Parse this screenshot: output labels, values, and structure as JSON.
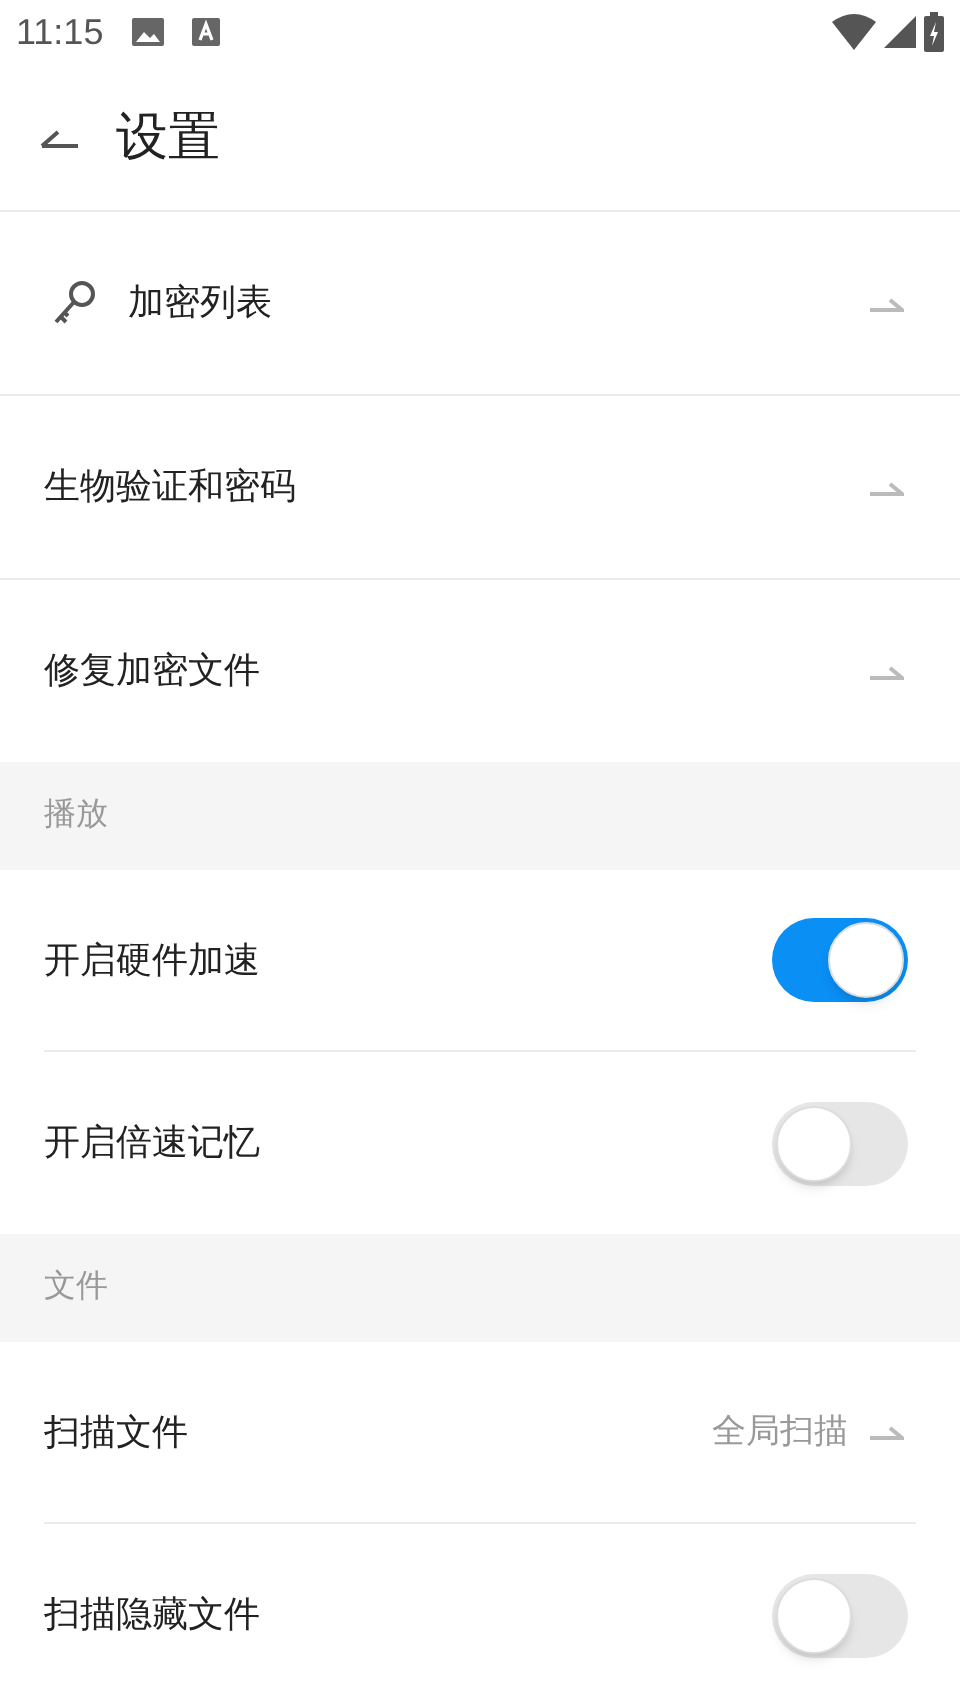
{
  "status_bar": {
    "time": "11:15"
  },
  "header": {
    "title": "设置"
  },
  "groups": [
    {
      "items": [
        {
          "kind": "nav",
          "label": "加密列表",
          "has_icon": true
        },
        {
          "kind": "nav",
          "label": "生物验证和密码"
        },
        {
          "kind": "nav",
          "label": "修复加密文件"
        }
      ]
    },
    {
      "title": "播放",
      "items": [
        {
          "kind": "toggle",
          "label": "开启硬件加速",
          "on": true
        },
        {
          "kind": "toggle",
          "label": "开启倍速记忆",
          "on": false
        }
      ]
    },
    {
      "title": "文件",
      "items": [
        {
          "kind": "nav",
          "label": "扫描文件",
          "value": "全局扫描"
        },
        {
          "kind": "toggle",
          "label": "扫描隐藏文件",
          "on": false
        }
      ]
    }
  ]
}
